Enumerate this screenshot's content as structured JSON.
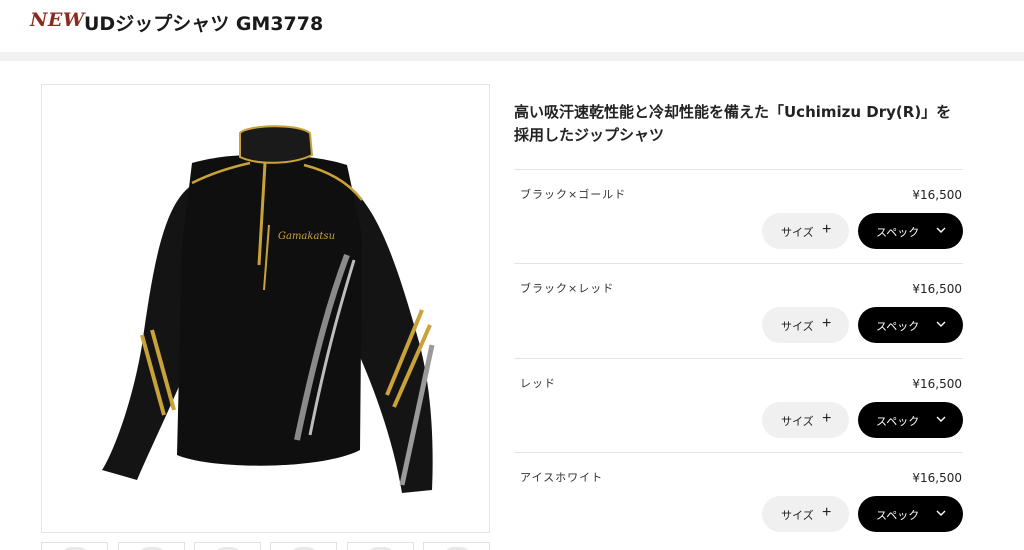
{
  "header": {
    "badge": "NEW",
    "title": "UDジップシャツ GM3778"
  },
  "product": {
    "image_icon": "jacket-image",
    "logo_text": "Gamakatsu",
    "description": "高い吸汗速乾性能と冷却性能を備えた「Uchimizu Dry(R)」を採用したジップシャツ"
  },
  "variants": [
    {
      "name": "ブラック×ゴールド",
      "price": "¥16,500",
      "size_label": "サイズ",
      "spec_label": "スペック"
    },
    {
      "name": "ブラック×レッド",
      "price": "¥16,500",
      "size_label": "サイズ",
      "spec_label": "スペック"
    },
    {
      "name": "レッド",
      "price": "¥16,500",
      "size_label": "サイズ",
      "spec_label": "スペック"
    },
    {
      "name": "アイスホワイト",
      "price": "¥16,500",
      "size_label": "サイズ",
      "spec_label": "スペック"
    }
  ],
  "colors": {
    "badge": "#8b2a1f",
    "spec_button": "#000000",
    "size_button": "#f0f0f0",
    "accent_gold": "#c9a23a"
  }
}
